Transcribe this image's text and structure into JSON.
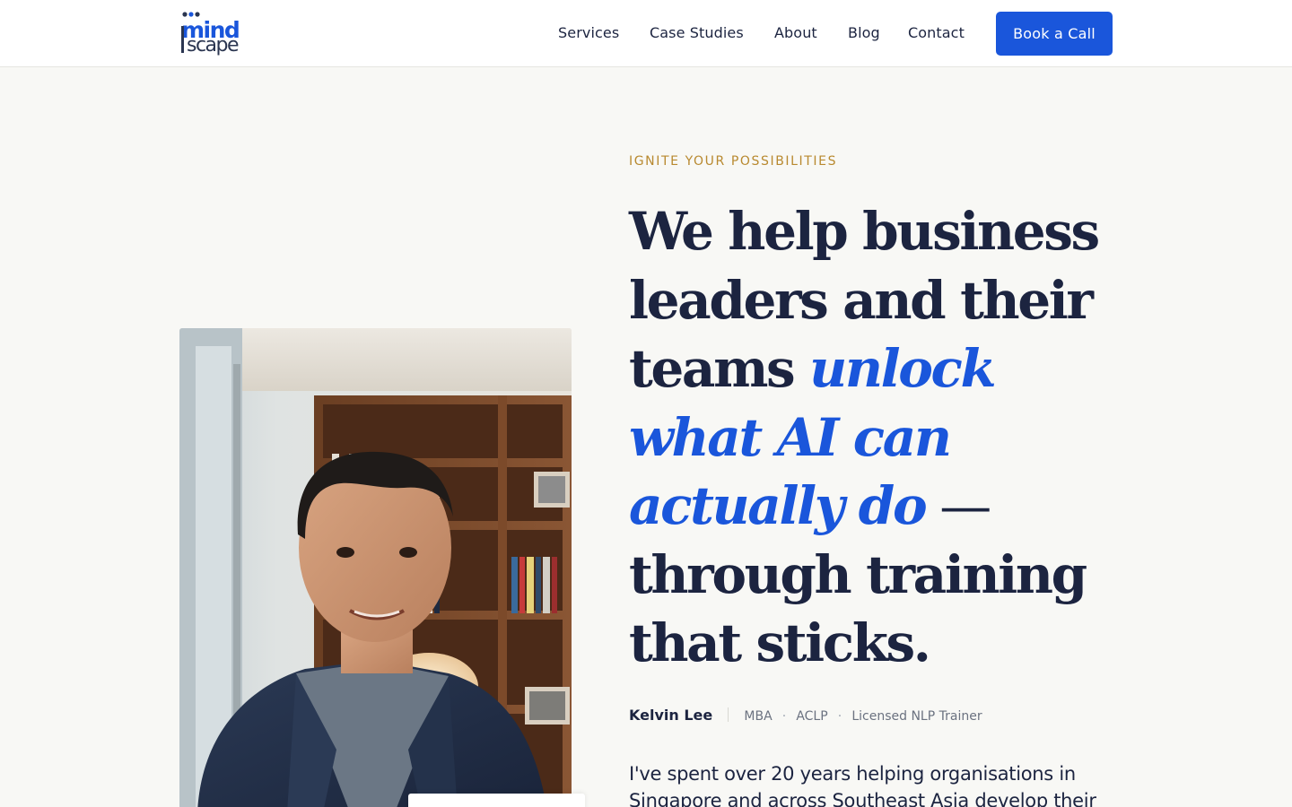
{
  "brand": {
    "logo_top": "mind",
    "logo_bottom": "scape",
    "colors": {
      "primary": "#1a56db",
      "navy": "#1c2440",
      "eyebrow": "#b8892f",
      "background": "#f8f8f5"
    }
  },
  "nav": {
    "items": [
      {
        "label": "Services"
      },
      {
        "label": "Case Studies"
      },
      {
        "label": "About"
      },
      {
        "label": "Blog"
      },
      {
        "label": "Contact"
      }
    ],
    "cta_label": "Book a Call"
  },
  "hero": {
    "eyebrow": "IGNITE YOUR POSSIBILITIES",
    "headline": {
      "line1": "We help business",
      "line2": "leaders and their",
      "line3_plain": "teams ",
      "line3_em": "unlock",
      "line4_em": "what AI can",
      "line5_em": "actually do",
      "line5_dash": " —",
      "line6": "through training",
      "line7": "that sticks."
    },
    "credentials": {
      "name": "Kelvin Lee",
      "items": [
        "MBA",
        "ACLP",
        "Licensed NLP Trainer"
      ],
      "separator": "·"
    },
    "lede": "I've spent over 20 years helping organisations in Singapore and across Southeast Asia develop their",
    "photo_icon": "portrait-photo"
  }
}
